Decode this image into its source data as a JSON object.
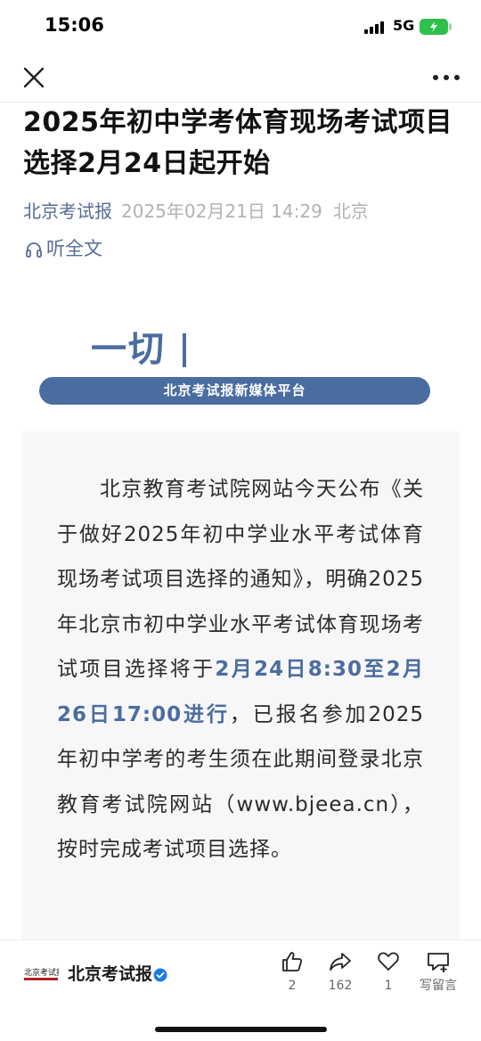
{
  "status_bar": {
    "time": "15:06",
    "network": "5G",
    "battery_state": "charging",
    "battery_color": "#2fbf4d"
  },
  "nav": {
    "close_icon": "close-icon",
    "more_icon": "more-icon"
  },
  "article": {
    "title": "2025年初中学考体育现场考试项目选择2月24日起开始",
    "source": "北京考试报",
    "time": "2025年02月21日 14:29",
    "location": "北京",
    "listen_label": "听全文",
    "banner_text": "一切",
    "banner_bar": "北京考试报新媒体平台",
    "body_before": "北京教育考试院网站今天公布《关于做好2025年初中学业水平考试体育现场考试项目选择的通知》，明确2025年北京市初中学业水平考试体育现场考试项目选择将于",
    "body_highlight": "2月24日8:30至2月26日17:00进行",
    "body_after": "，已报名参加2025年初中学考的考生须在此期间登录北京教育考试院网站（www.bjeea.cn），按时完成考试项目选择。",
    "accent_color": "#4a6da0",
    "link_color": "#576b95"
  },
  "toolbar": {
    "account_name": "北京考试报",
    "like_count": "2",
    "share_count": "162",
    "love_count": "1",
    "comment_label": "写留言"
  }
}
